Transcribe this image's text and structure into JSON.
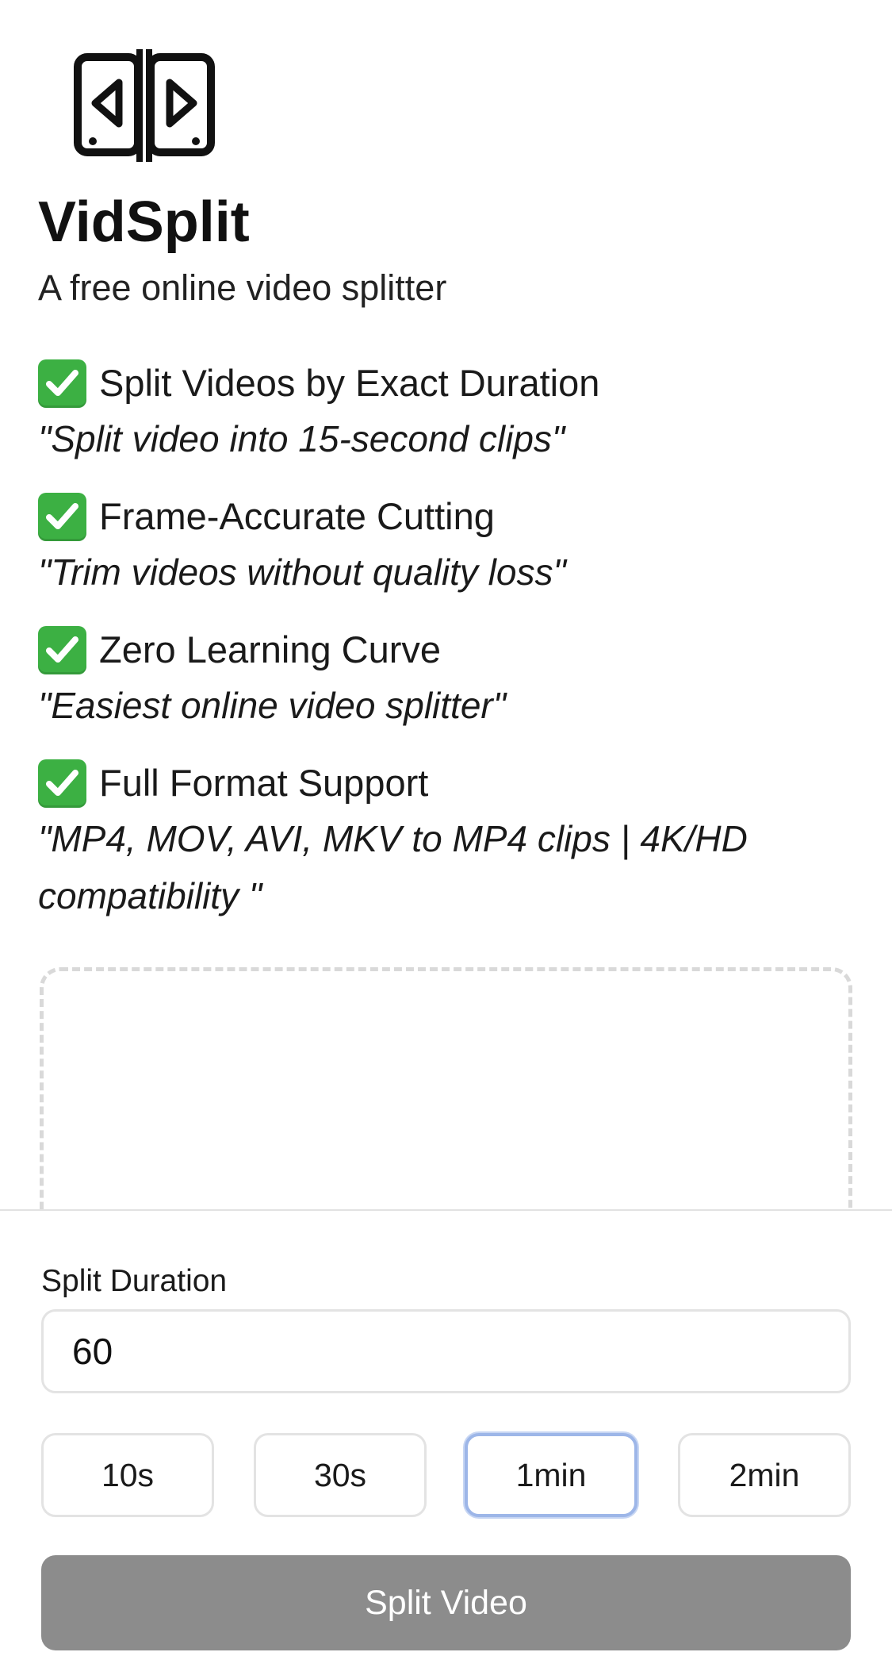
{
  "app": {
    "title": "VidSplit",
    "tagline": "A free online video splitter",
    "logo_icon": "split-video-icon"
  },
  "features": [
    {
      "icon": "check-mark-icon",
      "title": "Split Videos by Exact Duration",
      "quote": "\"Split video into 15-second clips\""
    },
    {
      "icon": "check-mark-icon",
      "title": "Frame-Accurate Cutting",
      "quote": "\"Trim videos without quality loss\""
    },
    {
      "icon": "check-mark-icon",
      "title": "Zero Learning Curve",
      "quote": "\"Easiest online video splitter\""
    },
    {
      "icon": "check-mark-icon",
      "title": "Full Format Support",
      "quote": "\"MP4, MOV, AVI, MKV to MP4 clips | 4K/HD compatibility \""
    }
  ],
  "controls": {
    "duration_label": "Split Duration",
    "duration_value": "60",
    "presets": [
      {
        "label": "10s",
        "selected": false
      },
      {
        "label": "30s",
        "selected": false
      },
      {
        "label": "1min",
        "selected": true
      },
      {
        "label": "2min",
        "selected": false
      }
    ],
    "split_button_label": "Split Video"
  },
  "colors": {
    "check_green": "#3cb043",
    "button_disabled": "#8c8c8c",
    "selected_border": "#9db6e8",
    "dashed_border": "#d9d9d9"
  }
}
